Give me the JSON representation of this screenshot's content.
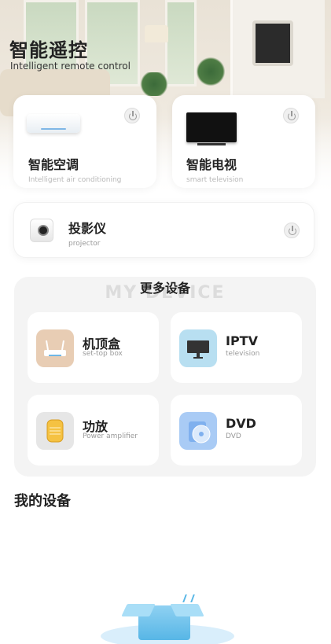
{
  "header": {
    "title": "智能遥控",
    "subtitle": "Intelligent remote control"
  },
  "top_devices": [
    {
      "name": "智能空调",
      "en": "Intelligent air conditioning",
      "icon": "air-conditioner-icon"
    },
    {
      "name": "智能电视",
      "en": "smart television",
      "icon": "tv-icon"
    }
  ],
  "projector": {
    "name": "投影仪",
    "en": "projector",
    "icon": "projector-icon"
  },
  "more_devices": {
    "title": "更多设备",
    "watermark": "MY DEVICE",
    "items": [
      {
        "name": "机顶盒",
        "en": "set-top box",
        "icon": "router-icon",
        "bg": "#e8cdb4"
      },
      {
        "name": "IPTV",
        "en": "television",
        "icon": "monitor-icon",
        "bg": "#b8dff1"
      },
      {
        "name": "功放",
        "en": "Power amplifier",
        "icon": "speaker-icon",
        "bg": "#e6e6e6"
      },
      {
        "name": "DVD",
        "en": "DVD",
        "icon": "disc-icon",
        "bg": "#a9cbf5"
      }
    ]
  },
  "my_devices": {
    "title": "我的设备",
    "empty_icon": "empty-box-icon"
  },
  "colors": {
    "accent_blue": "#57b6e6",
    "panel_gray": "#f4f4f4"
  }
}
